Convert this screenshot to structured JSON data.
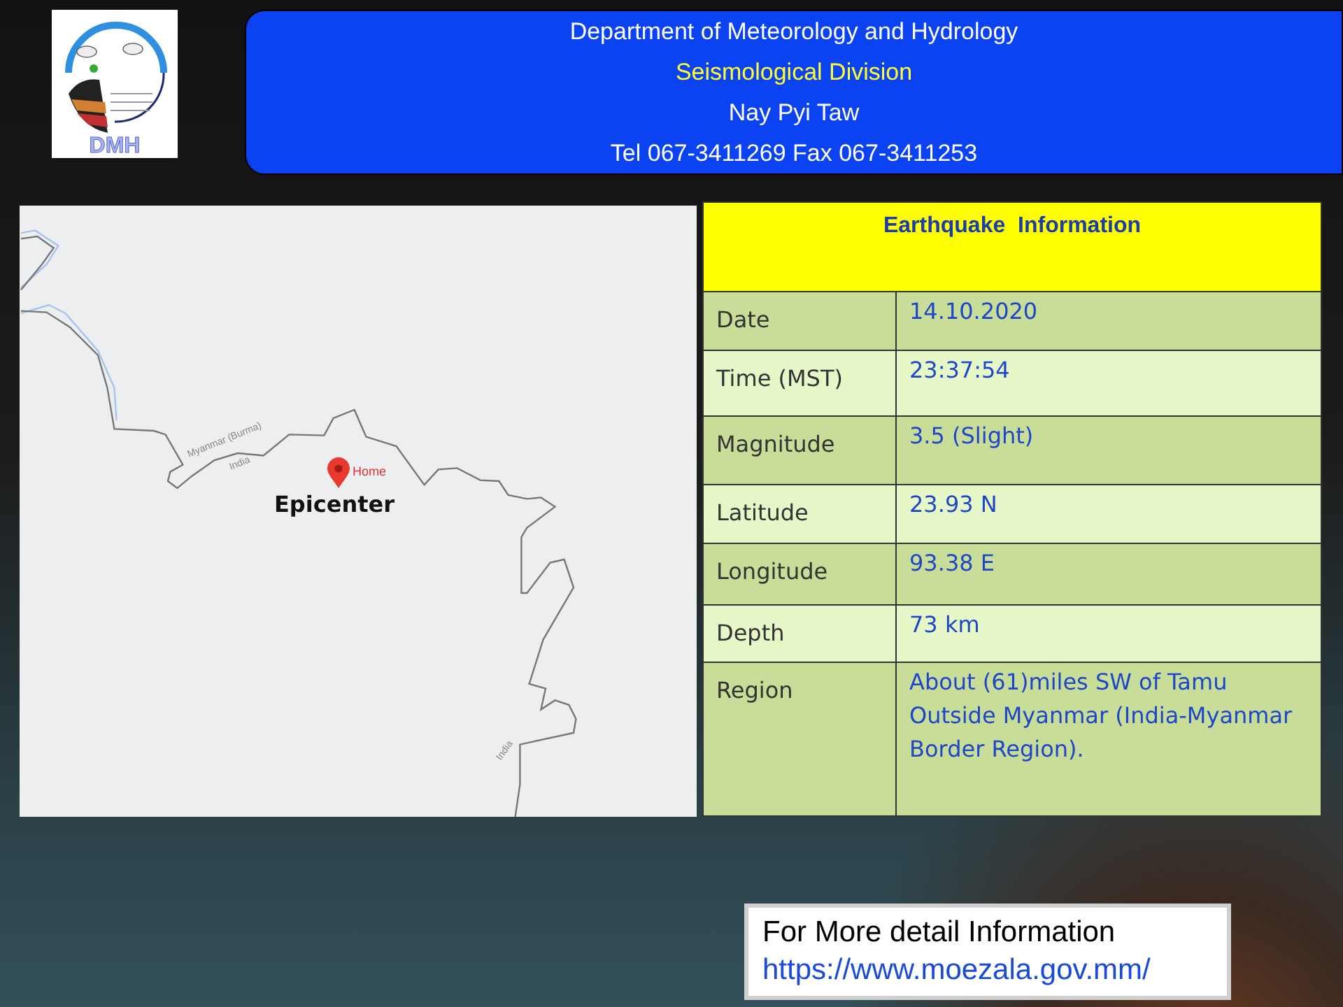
{
  "header": {
    "logo_text": "DMH",
    "lines": [
      {
        "text": "Department of Meteorology and Hydrology",
        "kind": "plain"
      },
      {
        "text": "Seismological Division",
        "kind": "highlight"
      },
      {
        "text": "Nay Pyi Taw",
        "kind": "plain"
      },
      {
        "text": "Tel 067-3411269 Fax 067-3411253",
        "kind": "plain"
      }
    ]
  },
  "map": {
    "border_labels": [
      "Myanmar (Burma)",
      "India",
      "India"
    ],
    "pin_label": "Home",
    "marker_label": "Epicenter"
  },
  "info_table": {
    "title": "Earthquake  Information",
    "rows": [
      {
        "label": "Date",
        "value": "14.10.2020"
      },
      {
        "label": "Time (MST)",
        "value": "23:37:54"
      },
      {
        "label": "Magnitude",
        "value": "3.5 (Slight)"
      },
      {
        "label": "Latitude",
        "value": "23.93  N"
      },
      {
        "label": "Longitude",
        "value": "93.38  E"
      },
      {
        "label": "Depth",
        "value": "73 km"
      },
      {
        "label": "Region",
        "value": "About (61)miles SW of Tamu Outside Myanmar (India-Myanmar Border Region)."
      }
    ]
  },
  "more_info": {
    "text": "For More detail Information",
    "link": "https://www.moezala.gov.mm/"
  }
}
